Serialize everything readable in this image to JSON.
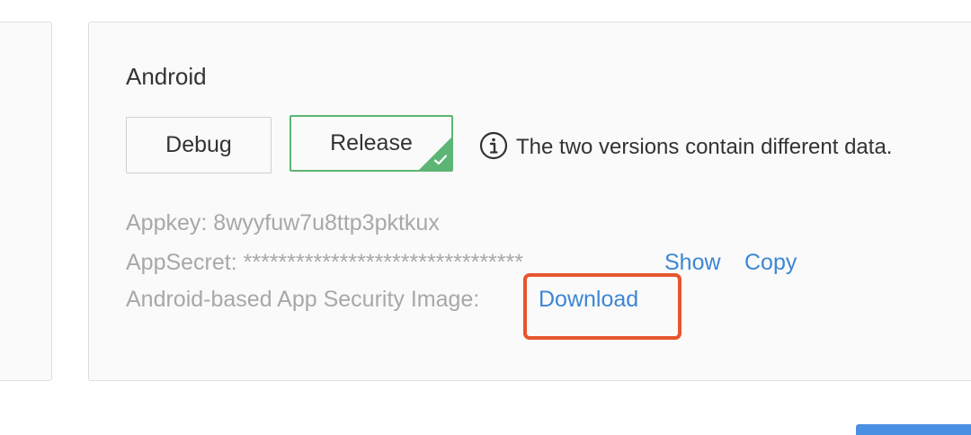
{
  "platform": {
    "title": "Android"
  },
  "version_tabs": {
    "debug_label": "Debug",
    "release_label": "Release",
    "selected": "Release"
  },
  "info": {
    "icon": "info-icon",
    "text": "The two versions contain different data."
  },
  "credentials": {
    "appkey_label": "Appkey:",
    "appkey_value": "8wyyfuw7u8ttp3pktkux",
    "appsecret_label": "AppSecret:",
    "appsecret_value": "********************************",
    "show_label": "Show",
    "copy_label": "Copy",
    "security_image_label": "Android-based App Security Image:",
    "download_label": "Download"
  },
  "colors": {
    "accent_green": "#5cb574",
    "link_blue": "#3d86d4",
    "highlight_red": "#e8552e",
    "primary_blue": "#4a90e2"
  }
}
